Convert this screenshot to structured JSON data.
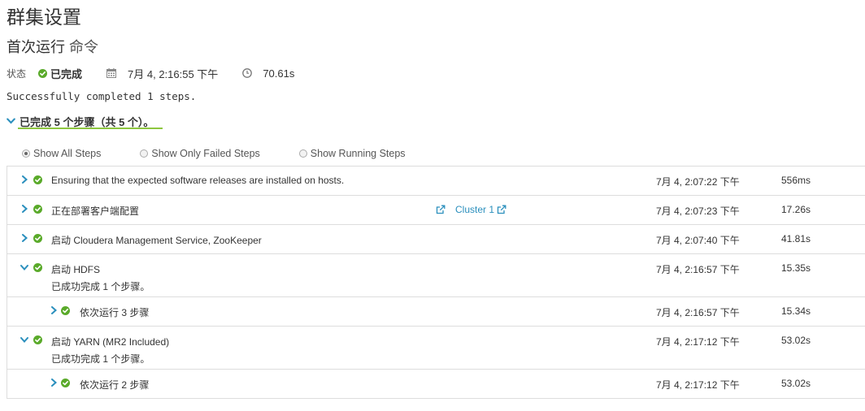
{
  "page": {
    "title": "群集设置",
    "subtitle": "首次运行",
    "command": "命令"
  },
  "status": {
    "label": "状态",
    "value": "已完成",
    "date": "7月 4, 2:16:55 下午",
    "duration": "70.61s"
  },
  "result_message": "Successfully completed 1 steps.",
  "steps_toggle": "已完成 5 个步骤（共 5 个）。",
  "filters": {
    "options": [
      "Show All Steps",
      "Show Only Failed Steps",
      "Show Running Steps"
    ],
    "selected": "Show All Steps"
  },
  "steps": [
    {
      "name": "Ensuring that the expected software releases are installed on hosts.",
      "time": "7月 4, 2:07:22 下午",
      "duration": "556ms",
      "expanded": false,
      "level": 0
    },
    {
      "name": "正在部署客户端配置",
      "link": "Cluster 1",
      "time": "7月 4, 2:07:23 下午",
      "duration": "17.26s",
      "expanded": false,
      "level": 0
    },
    {
      "name": "启动 Cloudera Management Service, ZooKeeper",
      "time": "7月 4, 2:07:40 下午",
      "duration": "41.81s",
      "expanded": false,
      "level": 0
    },
    {
      "name": "启动 HDFS",
      "detail": "已成功完成 1 个步骤。",
      "time": "7月 4, 2:16:57 下午",
      "duration": "15.35s",
      "expanded": true,
      "level": 0
    },
    {
      "name": "依次运行 3 步骤",
      "time": "7月 4, 2:16:57 下午",
      "duration": "15.34s",
      "expanded": false,
      "level": 1
    },
    {
      "name": "启动 YARN (MR2 Included)",
      "detail": "已成功完成 1 个步骤。",
      "time": "7月 4, 2:17:12 下午",
      "duration": "53.02s",
      "expanded": true,
      "level": 0
    },
    {
      "name": "依次运行 2 步骤",
      "time": "7月 4, 2:17:12 下午",
      "duration": "53.02s",
      "expanded": false,
      "level": 1
    }
  ],
  "colors": {
    "success": "#5aaa2a",
    "accent": "#8dc63f",
    "link": "#2a8fbd",
    "border": "#dddddd"
  },
  "icons": {
    "status": "check-circle-icon",
    "date": "calendar-icon",
    "duration": "clock-icon",
    "expand": "chevron-right-icon",
    "collapse": "chevron-down-icon",
    "link": "external-link-icon"
  }
}
